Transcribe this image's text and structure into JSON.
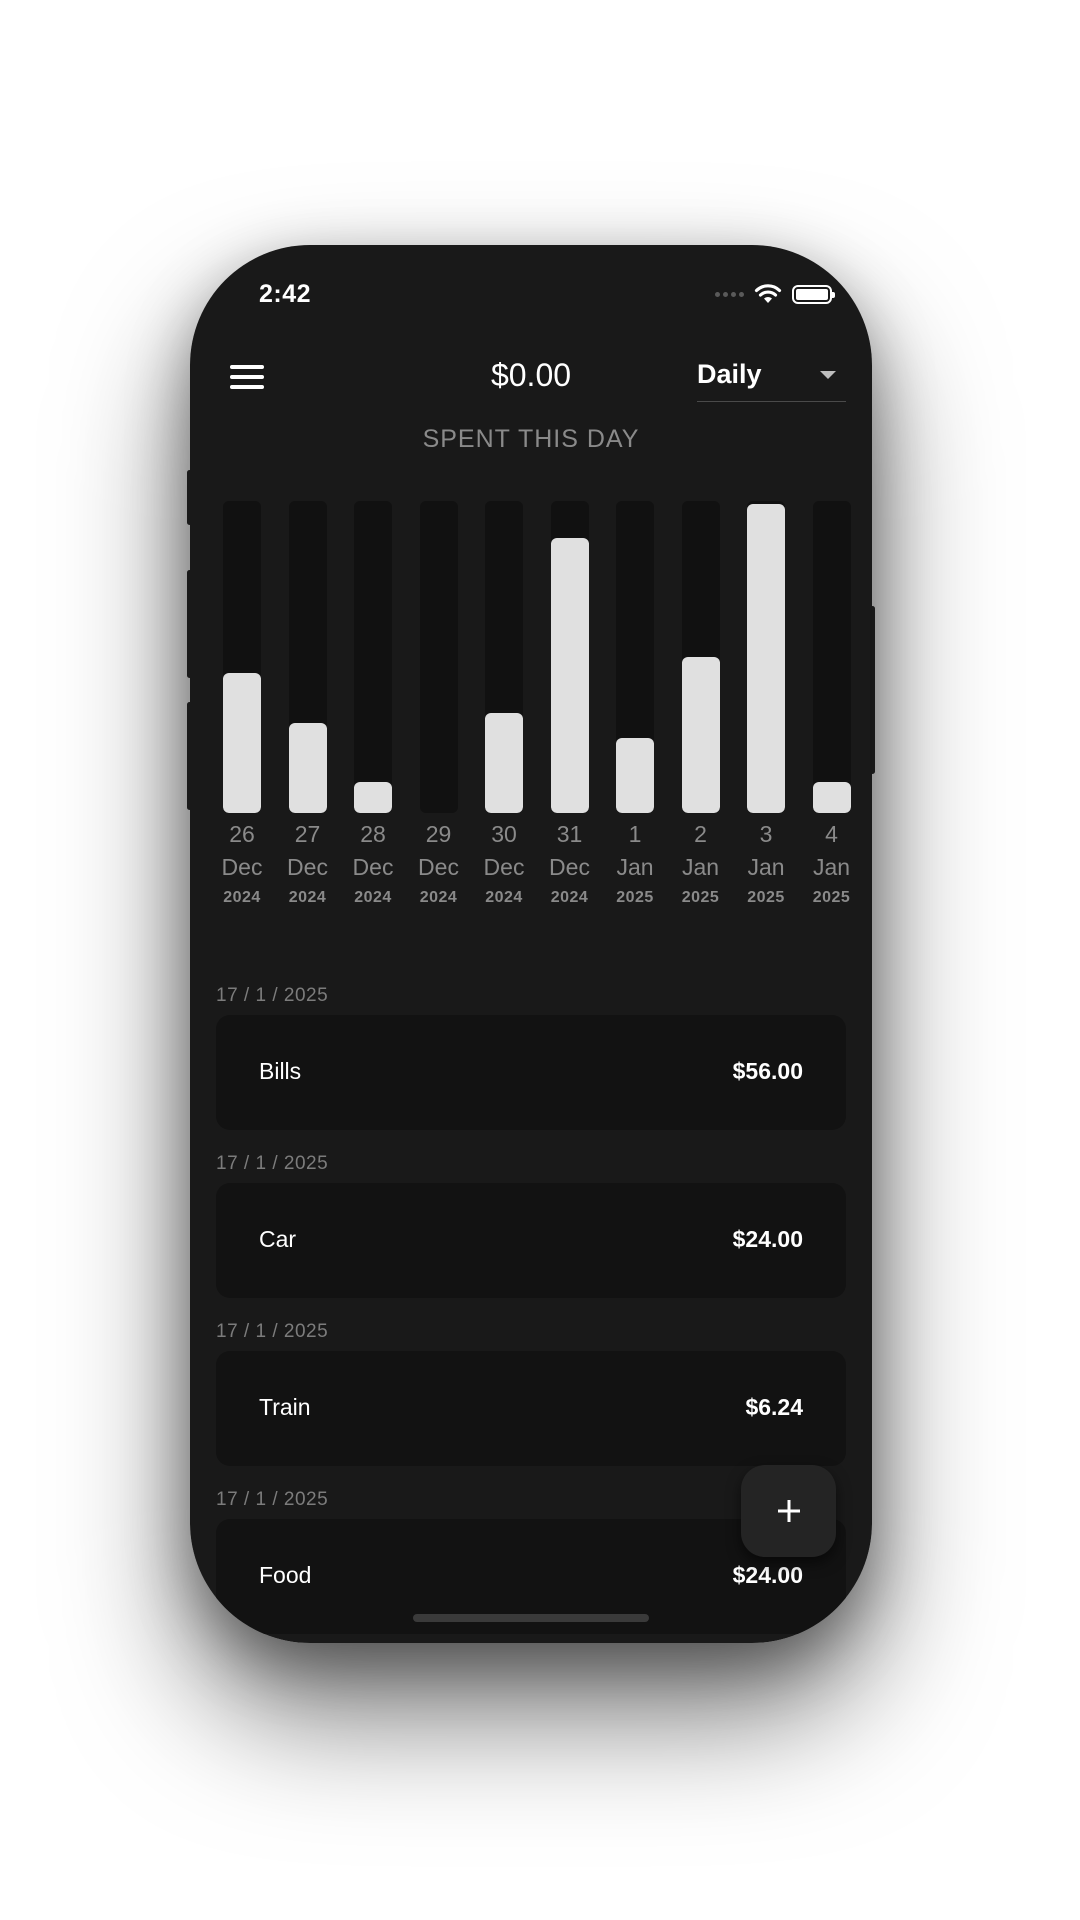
{
  "status_bar": {
    "time": "2:42"
  },
  "header": {
    "total": "$0.00",
    "period": "Daily",
    "subtitle": "SPENT THIS DAY"
  },
  "chart_data": {
    "type": "bar",
    "categories": [
      "26 Dec 2024",
      "27 Dec 2024",
      "28 Dec 2024",
      "29 Dec 2024",
      "30 Dec 2024",
      "31 Dec 2024",
      "1 Jan 2025",
      "2 Jan 2025",
      "3 Jan 2025",
      "4 Jan 2025"
    ],
    "labels": [
      {
        "day": "26",
        "month": "Dec",
        "year": "2024"
      },
      {
        "day": "27",
        "month": "Dec",
        "year": "2024"
      },
      {
        "day": "28",
        "month": "Dec",
        "year": "2024"
      },
      {
        "day": "29",
        "month": "Dec",
        "year": "2024"
      },
      {
        "day": "30",
        "month": "Dec",
        "year": "2024"
      },
      {
        "day": "31",
        "month": "Dec",
        "year": "2024"
      },
      {
        "day": "1",
        "month": "Jan",
        "year": "2025"
      },
      {
        "day": "2",
        "month": "Jan",
        "year": "2025"
      },
      {
        "day": "3",
        "month": "Jan",
        "year": "2025"
      },
      {
        "day": "4",
        "month": "Jan",
        "year": "2025"
      }
    ],
    "values": [
      0.45,
      0.29,
      0.1,
      0,
      0.32,
      0.88,
      0.24,
      0.5,
      0.99,
      0.1
    ],
    "ylim": [
      0,
      1
    ]
  },
  "entries": [
    {
      "date": "17 / 1 / 2025",
      "name": "Bills",
      "amount": "$56.00"
    },
    {
      "date": "17 / 1 / 2025",
      "name": "Car",
      "amount": "$24.00"
    },
    {
      "date": "17 / 1 / 2025",
      "name": "Train",
      "amount": "$6.24"
    },
    {
      "date": "17 / 1 / 2025",
      "name": "Food",
      "amount": "$24.00"
    }
  ],
  "fab": {
    "icon": "plus-icon",
    "label": "+"
  },
  "colors": {
    "background": "#191919",
    "card": "#121212",
    "bar": "#e0e0e0",
    "muted_text": "#8a8a8a"
  }
}
